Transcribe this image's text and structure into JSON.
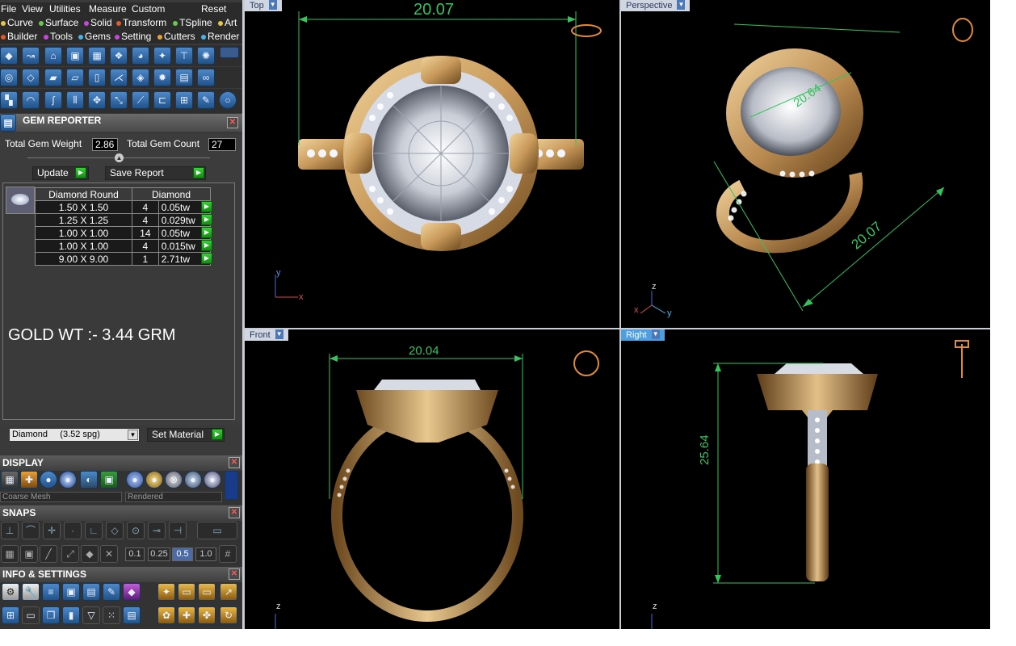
{
  "menu": {
    "file": "File",
    "view": "View",
    "utilities": "Utilities",
    "measure": "Measure",
    "custom": "Custom",
    "reset": "Reset"
  },
  "modules1": [
    {
      "label": "Curve",
      "color": "#e8c54a"
    },
    {
      "label": "Surface",
      "color": "#6ac94a"
    },
    {
      "label": "Solid",
      "color": "#c548d9"
    },
    {
      "label": "Transform",
      "color": "#e05a2a"
    },
    {
      "label": "TSpline",
      "color": "#6ac94a"
    },
    {
      "label": "Art",
      "color": "#e8c54a"
    }
  ],
  "modules2": [
    {
      "label": "Builder",
      "color": "#e05a2a"
    },
    {
      "label": "Tools",
      "color": "#c548d9"
    },
    {
      "label": "Gems",
      "color": "#4ab3e8"
    },
    {
      "label": "Setting",
      "color": "#c548d9"
    },
    {
      "label": "Cutters",
      "color": "#e8a03a"
    },
    {
      "label": "Render",
      "color": "#4ab3e8"
    }
  ],
  "gem_reporter": {
    "title": "GEM REPORTER",
    "total_weight_label": "Total Gem Weight",
    "total_weight_value": "2.86",
    "total_count_label": "Total Gem Count",
    "total_count_value": "27",
    "update_label": "Update",
    "save_label": "Save Report",
    "col1": "Diamond Round",
    "col2": "Diamond",
    "rows": [
      {
        "size": "1.50 X 1.50",
        "count": "4",
        "weight": "0.05tw"
      },
      {
        "size": "1.25 X 1.25",
        "count": "4",
        "weight": "0.029tw"
      },
      {
        "size": "1.00 X 1.00",
        "count": "14",
        "weight": "0.05tw"
      },
      {
        "size": "1.00 X 1.00",
        "count": "4",
        "weight": "0.015tw"
      },
      {
        "size": "9.00 X 9.00",
        "count": "1",
        "weight": "2.71tw"
      }
    ],
    "note": "GOLD WT :- 3.44 GRM",
    "material_value": "Diamond     (3.52 spg)",
    "set_material_label": "Set Material"
  },
  "display": {
    "title": "DISPLAY",
    "mesh": "Coarse Mesh",
    "mode": "Rendered"
  },
  "snaps": {
    "title": "SNAPS",
    "vals": [
      "0.1",
      "0.25",
      "0.5",
      "1.0"
    ]
  },
  "info": {
    "title": "INFO & SETTINGS"
  },
  "viewports": {
    "top": {
      "label": "Top",
      "dim": "20.07",
      "axis_x": "x",
      "axis_y": "y"
    },
    "perspective": {
      "label": "Perspective",
      "dim1": "20.64",
      "dim2": "20.07",
      "axis_x": "x",
      "axis_y": "y",
      "axis_z": "z"
    },
    "front": {
      "label": "Front",
      "dim": "20.04",
      "axis_z": "z"
    },
    "right": {
      "label": "Right",
      "dim": "25.64",
      "axis_z": "z"
    }
  },
  "colors": {
    "gold": "#c8a060",
    "dim_green": "#35c35e",
    "tab_active": "#4d9fe0"
  }
}
